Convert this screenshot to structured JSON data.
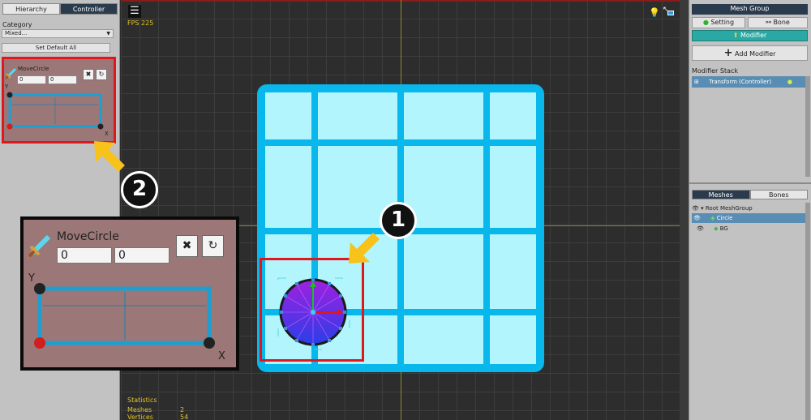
{
  "left_panel": {
    "tabs": [
      "Hierarchy",
      "Controller"
    ],
    "category_label": "Category",
    "category_value": "Mixed...",
    "set_default_label": "Set Default All",
    "controller": {
      "name": "MoveCircle",
      "x_value": "0",
      "y_value": "0",
      "axis_x_label": "X",
      "axis_y_label": "Y"
    }
  },
  "viewport": {
    "fps_text": "FPS 225",
    "stats": {
      "title": "Statistics",
      "meshes_label": "Meshes",
      "meshes_value": "2",
      "vertices_label": "Vertices",
      "vertices_value": "54"
    }
  },
  "right_panel": {
    "header": "Mesh Group",
    "setting_label": "Setting",
    "bone_label": "Bone",
    "modifier_label": "Modifier",
    "add_modifier_label": "Add Modifier",
    "modifier_stack_label": "Modifier Stack",
    "modifier_item": "Transform (Controller)",
    "tabs": [
      "Meshes",
      "Bones"
    ],
    "tree": {
      "root": "Root MeshGroup",
      "items": [
        "Circle",
        "BG"
      ]
    }
  },
  "annotations": {
    "badge_1": "1",
    "badge_2": "2"
  },
  "colors": {
    "highlight_red": "#e0181e",
    "arrow_yellow": "#f7c21a",
    "board_blue": "#08b7ec",
    "cell_fill": "#b2f5fc",
    "controller_bg": "#9b7777",
    "teal_active": "#2aa8a4"
  }
}
